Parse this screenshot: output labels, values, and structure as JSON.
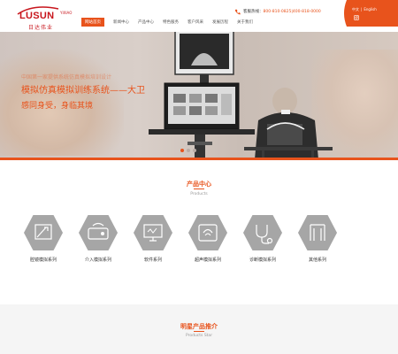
{
  "header": {
    "logo_text": "LUSUN",
    "logo_reg": "YIXIAO",
    "logo_cn": "日达伟业",
    "phone_label": "客服热线：",
    "phone_value": "800-810-0825|400-818-0000",
    "lang_cn": "中文",
    "lang_en": "English",
    "nav": [
      {
        "label": "网站首页",
        "active": true
      },
      {
        "label": "新闻中心",
        "active": false
      },
      {
        "label": "产品中心",
        "active": false
      },
      {
        "label": "特色服务",
        "active": false
      },
      {
        "label": "客户风采",
        "active": false
      },
      {
        "label": "发展历程",
        "active": false
      },
      {
        "label": "关于我们",
        "active": false
      }
    ]
  },
  "banner": {
    "line1": "中国第一家提供系统仿真模拟培训设计",
    "line2": "模拟仿真模拟训练系统——大卫",
    "line3": "感同身受，身临其境",
    "slides": 3,
    "active_slide": 1
  },
  "products": {
    "title": "产品中心",
    "subtitle": "Products",
    "items": [
      {
        "label": "腔镜模拟系列",
        "icon": "endoscope-icon"
      },
      {
        "label": "介入模拟系列",
        "icon": "interventional-icon"
      },
      {
        "label": "软件系列",
        "icon": "software-icon"
      },
      {
        "label": "超声模拟系列",
        "icon": "ultrasound-icon"
      },
      {
        "label": "诊断模拟系列",
        "icon": "stethoscope-icon"
      },
      {
        "label": "其他系列",
        "icon": "other-icon"
      }
    ]
  },
  "star": {
    "title": "明星产品推介",
    "subtitle": "Products Star"
  },
  "colors": {
    "accent": "#e8531c",
    "logo_red": "#c8161d",
    "hex_gray": "#a6a6a6"
  }
}
